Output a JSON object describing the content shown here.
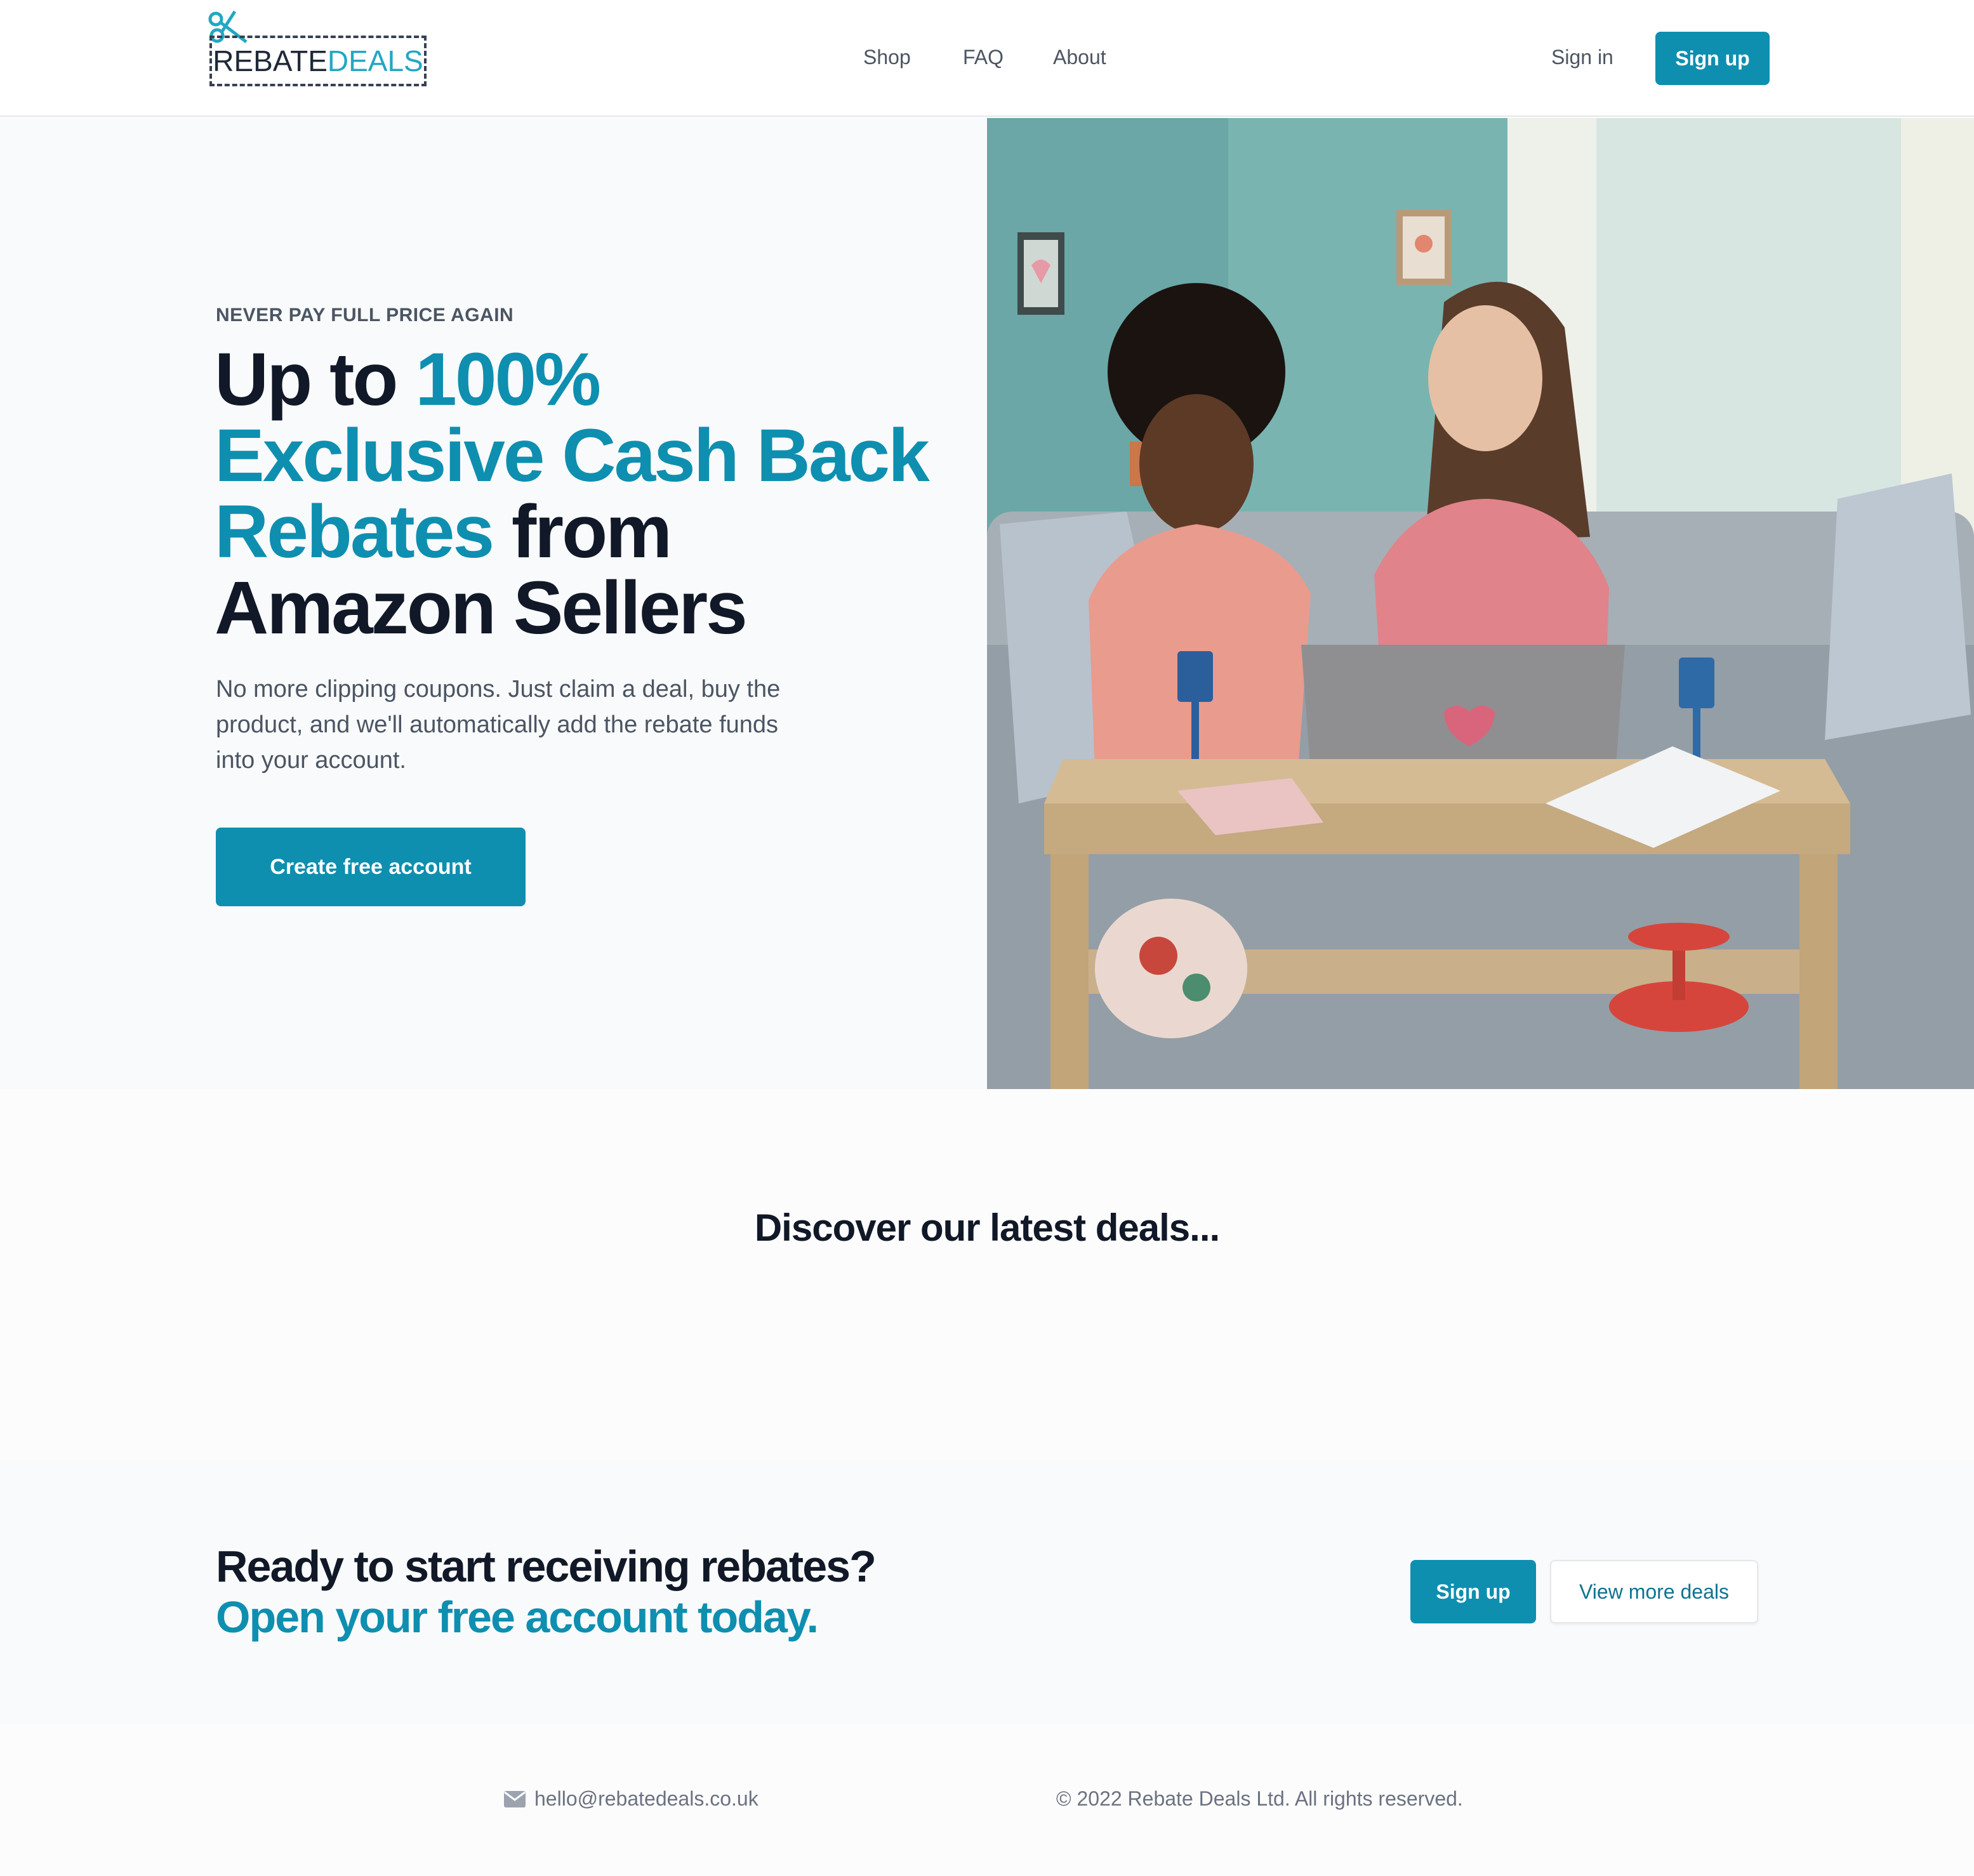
{
  "brand": {
    "logo_part1": "REBATE",
    "logo_part2": "DEALS",
    "accent_color": "#0e8fb0",
    "logo_accent_color": "#22a7c4"
  },
  "nav": {
    "items": [
      {
        "label": "Shop"
      },
      {
        "label": "FAQ"
      },
      {
        "label": "About"
      }
    ],
    "sign_in": "Sign in",
    "sign_up": "Sign up"
  },
  "hero": {
    "eyebrow": "NEVER PAY FULL PRICE AGAIN",
    "title_part1": "Up to ",
    "title_accent1": "100%",
    "title_accent2": "Exclusive Cash Back",
    "title_accent3": "Rebates",
    "title_part2": " from",
    "title_part3": "Amazon Sellers",
    "subtitle": "No more clipping coupons. Just claim a deal, buy the product, and we'll automatically add the rebate funds into your account.",
    "cta": "Create free account"
  },
  "deals": {
    "title": "Discover our latest deals..."
  },
  "cta_section": {
    "line1": "Ready to start receiving rebates?",
    "line2": "Open your free account today.",
    "sign_up": "Sign up",
    "view_more": "View more deals"
  },
  "footer": {
    "email": "hello@rebatedeals.co.uk",
    "copyright": "© 2022 Rebate Deals Ltd. All rights reserved.",
    "email_icon": "envelope-icon"
  }
}
